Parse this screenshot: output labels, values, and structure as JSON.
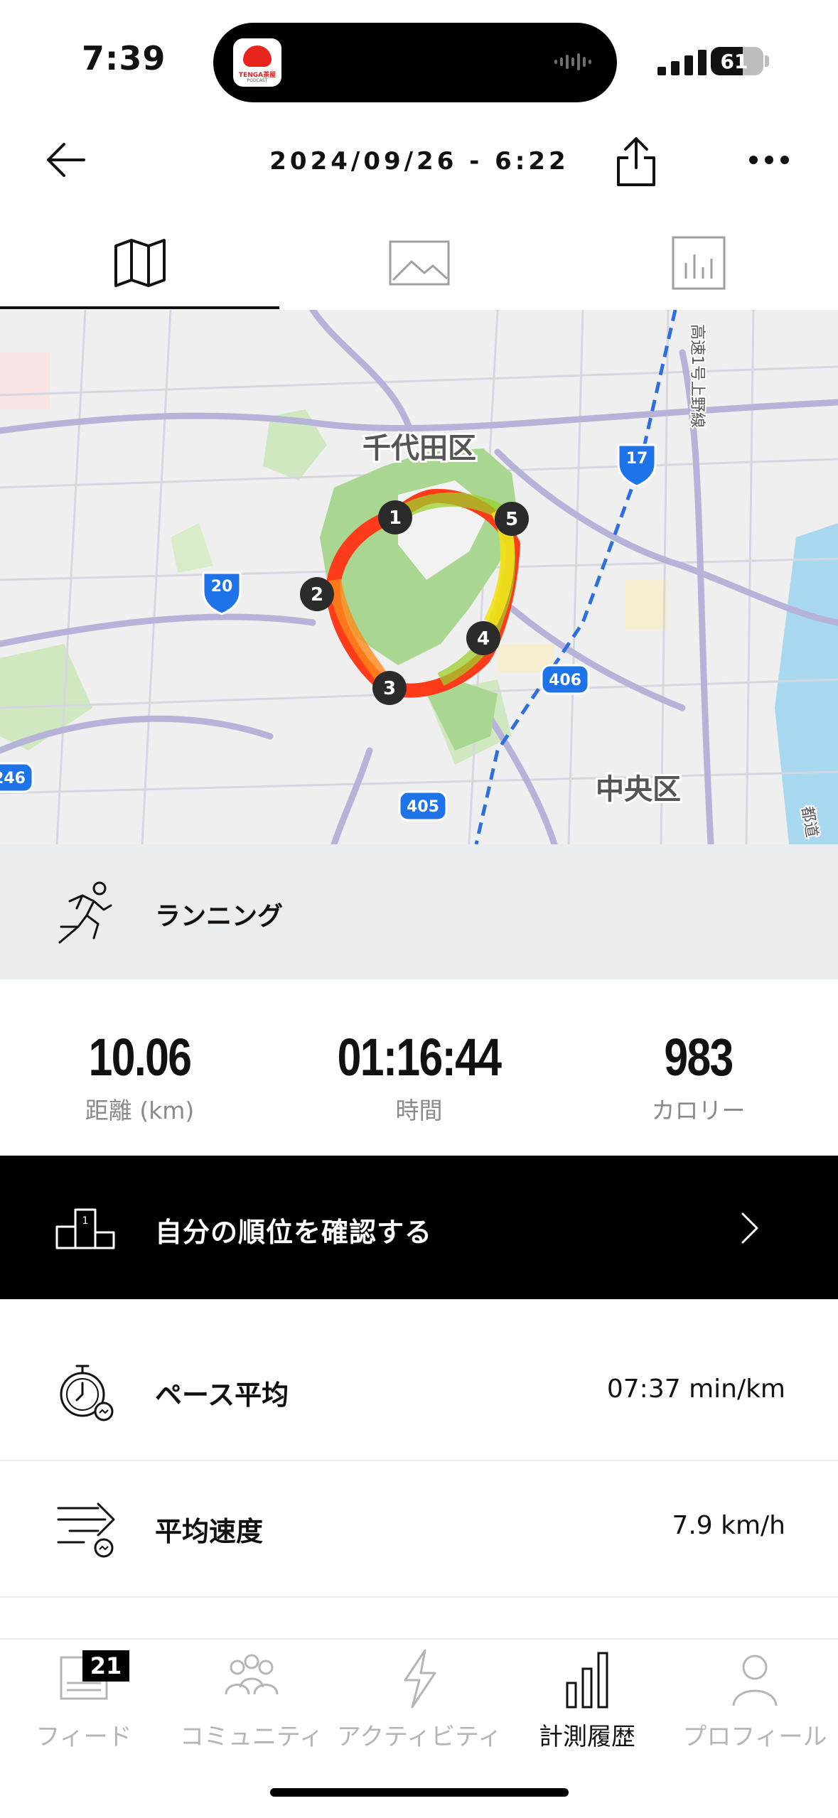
{
  "status_bar": {
    "time": "7:39",
    "battery": "61",
    "battery_level": 0.61,
    "now_playing_app": "TENGA茶屋",
    "now_playing_sub": "PODCAST"
  },
  "header": {
    "title": "2024/09/26 - 6:22"
  },
  "tabs": {
    "items": [
      "map-icon",
      "photo-icon",
      "chart-icon"
    ],
    "active": "map"
  },
  "map": {
    "labels": {
      "chiyoda": "千代田区",
      "chuo": "中央区",
      "shuto": "高速1号上野線",
      "toto": "都道"
    },
    "route_signs": [
      "17",
      "20",
      "406",
      "405",
      "246"
    ],
    "markers": [
      "1",
      "2",
      "3",
      "4",
      "5"
    ],
    "route_colors": [
      "#ff2a1a",
      "#ff8c1a",
      "#f5e51a",
      "#9bd22a"
    ]
  },
  "activity": {
    "type": "ランニング",
    "icon": "runner-icon"
  },
  "stats": {
    "distance": {
      "value": "10.06",
      "label": "距離 (km)"
    },
    "duration": {
      "value": "01:16:44",
      "label": "時間"
    },
    "calories": {
      "value": "983",
      "label": "カロリー"
    }
  },
  "rank": {
    "label": "自分の順位を確認する",
    "icon": "podium-icon"
  },
  "metrics": {
    "pace": {
      "name": "ペース平均",
      "value": "07:37 min/km",
      "icon": "stopwatch-icon"
    },
    "speed": {
      "name": "平均速度",
      "value": "7.9 km/h",
      "icon": "speed-icon"
    }
  },
  "nav": {
    "feed": {
      "label": "フィード",
      "badge": "21"
    },
    "community": {
      "label": "コミュニティ"
    },
    "activity": {
      "label": "アクティビティ"
    },
    "history": {
      "label": "計測履歴"
    },
    "profile": {
      "label": "プロフィール"
    },
    "active": "history"
  }
}
